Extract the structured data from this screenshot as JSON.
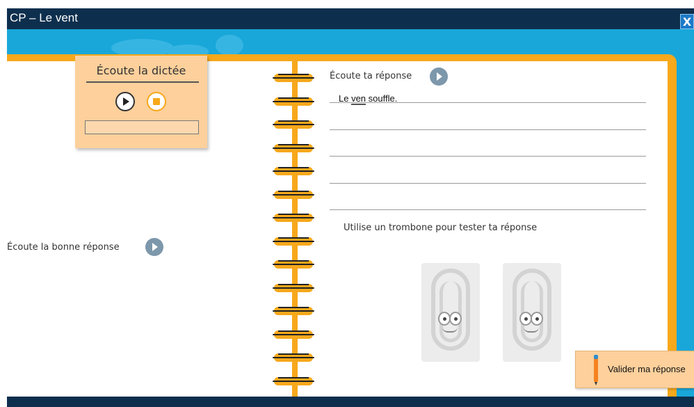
{
  "window": {
    "title": "CP – Le vent",
    "close_label": "X"
  },
  "colors": {
    "titlebar": "#0d2f4d",
    "background": "#19a7d9",
    "notebook_frame": "#f7a81b",
    "card": "#fdd09c",
    "play_circle": "#7d97ab"
  },
  "dictation_card": {
    "title": "Écoute la dictée",
    "play_icon": "play-icon",
    "stop_icon": "stop-icon"
  },
  "left_page": {
    "correct_answer_label": "Écoute la bonne réponse",
    "correct_answer_icon": "play-icon"
  },
  "right_page": {
    "listen_answer_label": "Écoute ta réponse",
    "listen_answer_icon": "play-icon",
    "answer_lines": [
      {
        "before": "Le ",
        "error": "ven",
        "after": " souffle."
      },
      {
        "text": ""
      },
      {
        "text": ""
      },
      {
        "text": ""
      },
      {
        "text": ""
      }
    ],
    "paperclip_prompt": "Utilise un trombone pour tester ta réponse",
    "paperclips": [
      "paperclip-icon",
      "paperclip-icon"
    ]
  },
  "validate_button": {
    "label": "Valider ma réponse",
    "icon": "pencil-icon"
  }
}
